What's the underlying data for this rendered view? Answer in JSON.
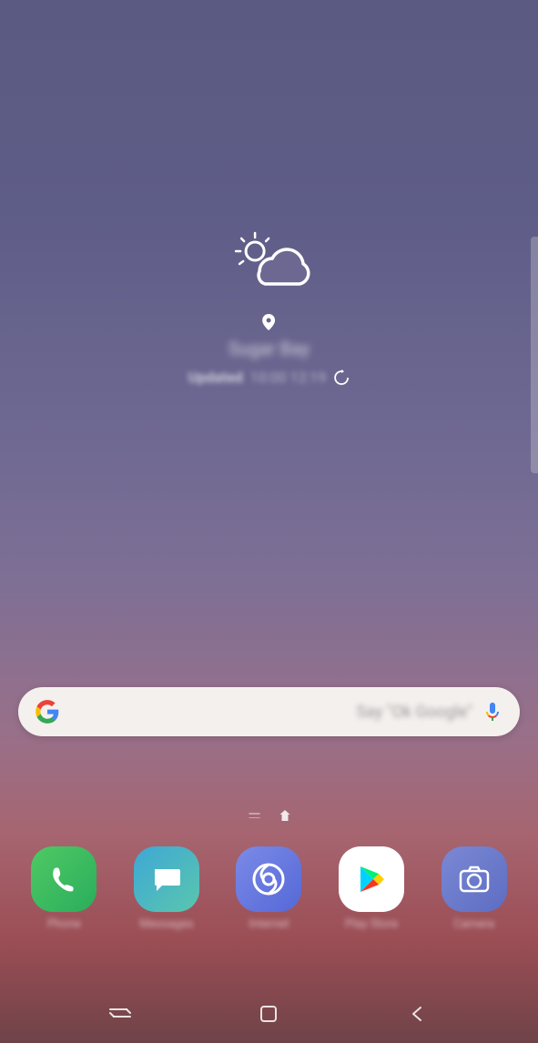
{
  "weather": {
    "location_name": "Sugar Bay",
    "update_label": "Updated",
    "update_time": "10:00 12:19"
  },
  "search": {
    "placeholder": "Say \"Ok Google\""
  },
  "dock": {
    "apps": [
      {
        "label": "Phone"
      },
      {
        "label": "Messages"
      },
      {
        "label": "Internet"
      },
      {
        "label": "Play Store"
      },
      {
        "label": "Camera"
      }
    ]
  }
}
